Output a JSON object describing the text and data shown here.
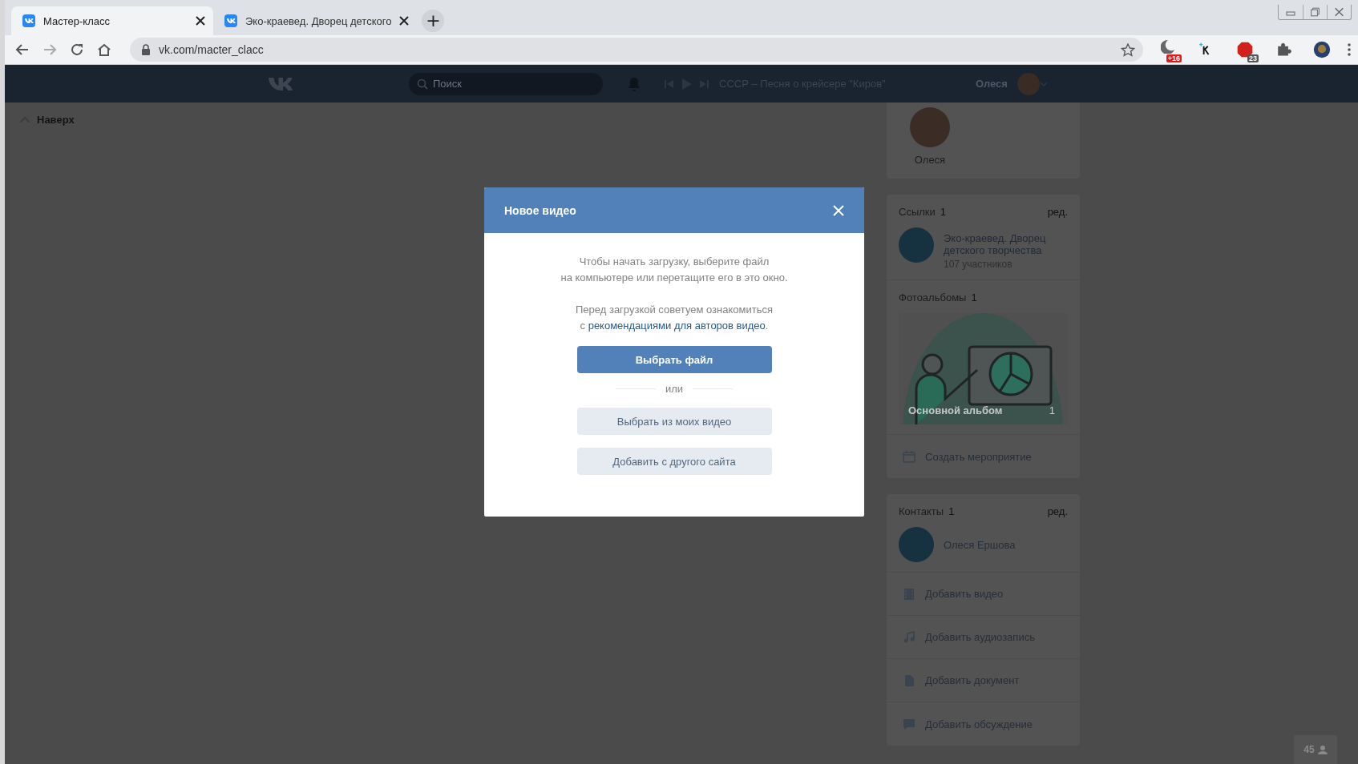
{
  "browser": {
    "tabs": [
      {
        "title": "Мастер-класс",
        "selected": true
      },
      {
        "title": "Эко-краевед. Дворец детского",
        "selected": false
      }
    ],
    "new_tab": "+",
    "address": "vk.com/macter_clacc",
    "extensions": [
      {
        "kind": "moon",
        "badge": "+16"
      },
      {
        "kind": "k"
      },
      {
        "kind": "abp",
        "badge": "23"
      },
      {
        "kind": "puzzle"
      },
      {
        "kind": "avatar"
      }
    ]
  },
  "header": {
    "search_placeholder": "Поиск",
    "track": "СССР – Песня о крейсере \"Киров\"",
    "user_name": "Олеся"
  },
  "back_to_top": "Наверх",
  "sidebar": {
    "profile_name": "Олеся",
    "links": {
      "title": "Ссылки",
      "count": "1",
      "edit": "ред.",
      "items": [
        {
          "name": "Эко-краевед. Дворец детского творчества",
          "members": "107 участников"
        }
      ]
    },
    "albums": {
      "title": "Фотоальбомы",
      "count": "1",
      "items": [
        {
          "title": "Основной альбом",
          "count": "1"
        }
      ]
    },
    "create_event": "Создать мероприятие",
    "contacts": {
      "title": "Контакты",
      "count": "1",
      "edit": "ред.",
      "items": [
        {
          "name": "Олеся Ершова"
        }
      ]
    },
    "actions": [
      {
        "kind": "video",
        "label": "Добавить видео"
      },
      {
        "kind": "audio",
        "label": "Добавить аудиозапись"
      },
      {
        "kind": "document",
        "label": "Добавить документ"
      },
      {
        "kind": "discussion",
        "label": "Добавить обсуждение"
      }
    ]
  },
  "modal": {
    "title": "Новое видео",
    "intro": "Чтобы начать загрузку, выберите файл\nна компьютере или перетащите его в это окно.",
    "advice": {
      "text": "Перед загрузкой советуем ознакомиться\nс ",
      "link": "рекомендациями для авторов видео",
      "after": "."
    },
    "primary_button": "Выбрать файл",
    "separator": "или",
    "secondary_buttons": [
      "Выбрать из моих видео",
      "Добавить с другого сайта"
    ]
  },
  "online_count": "45"
}
